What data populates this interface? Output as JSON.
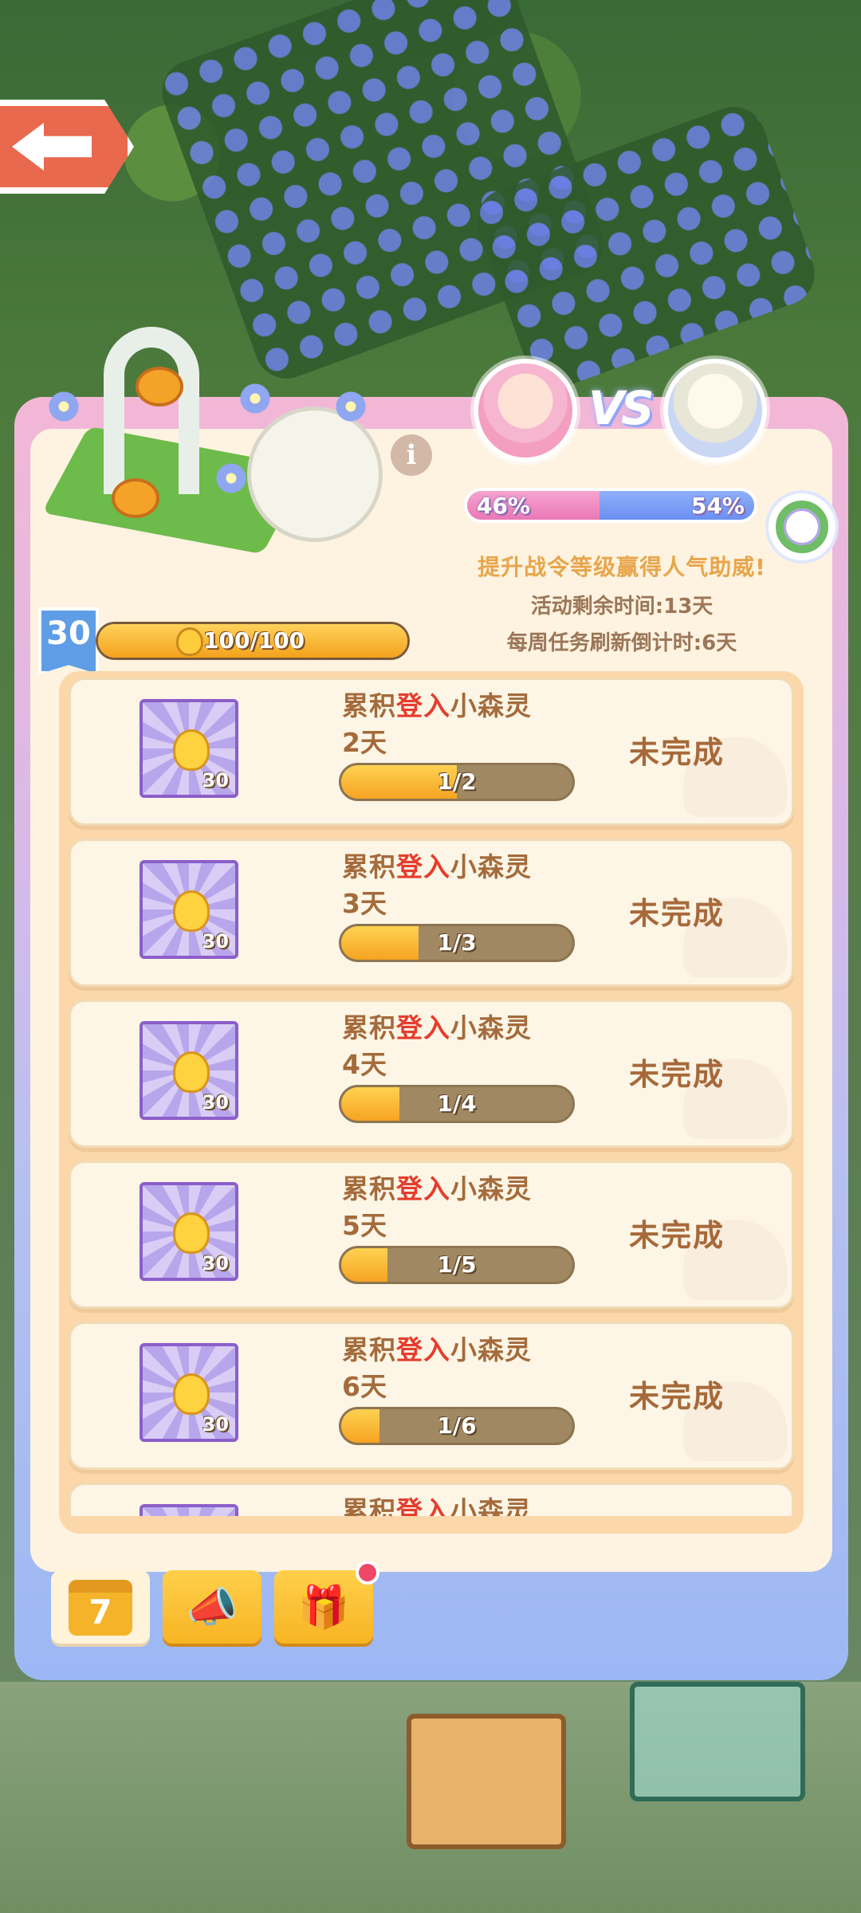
{
  "header": {
    "back_label": ""
  },
  "battle": {
    "vs_label": "VS",
    "left_percent": "46%",
    "right_percent": "54%",
    "left_share": 0.46,
    "promo_text": "提升战令等级赢得人气助威!",
    "activity_remaining": "活动剩余时间:13天",
    "weekly_refresh": "每周任务刷新倒计时:6天"
  },
  "level": {
    "value": "30",
    "exp_text": "100/100",
    "exp_fraction": 1.0
  },
  "tasks": [
    {
      "title_prefix": "累积",
      "title_highlight": "登入",
      "title_suffix": "小森灵",
      "days": "2天",
      "reward_qty": "30",
      "progress_text": "1/2",
      "progress": 0.5,
      "status": "未完成"
    },
    {
      "title_prefix": "累积",
      "title_highlight": "登入",
      "title_suffix": "小森灵",
      "days": "3天",
      "reward_qty": "30",
      "progress_text": "1/3",
      "progress": 0.333,
      "status": "未完成"
    },
    {
      "title_prefix": "累积",
      "title_highlight": "登入",
      "title_suffix": "小森灵",
      "days": "4天",
      "reward_qty": "30",
      "progress_text": "1/4",
      "progress": 0.25,
      "status": "未完成"
    },
    {
      "title_prefix": "累积",
      "title_highlight": "登入",
      "title_suffix": "小森灵",
      "days": "5天",
      "reward_qty": "30",
      "progress_text": "1/5",
      "progress": 0.2,
      "status": "未完成"
    },
    {
      "title_prefix": "累积",
      "title_highlight": "登入",
      "title_suffix": "小森灵",
      "days": "6天",
      "reward_qty": "30",
      "progress_text": "1/6",
      "progress": 0.167,
      "status": "未完成"
    },
    {
      "title_prefix": "累积",
      "title_highlight": "登入",
      "title_suffix": "小森灵",
      "days": "",
      "reward_qty": "",
      "progress_text": "",
      "progress": 0,
      "status": ""
    }
  ],
  "tabs": {
    "calendar_number": "7",
    "icons": [
      "calendar-icon",
      "horn-icon",
      "gift-icon"
    ]
  },
  "colors": {
    "pink_team": "#ea78b6",
    "blue_team": "#6b8ff0",
    "highlight_red": "#e53d2d",
    "notification": "#f0466a"
  }
}
